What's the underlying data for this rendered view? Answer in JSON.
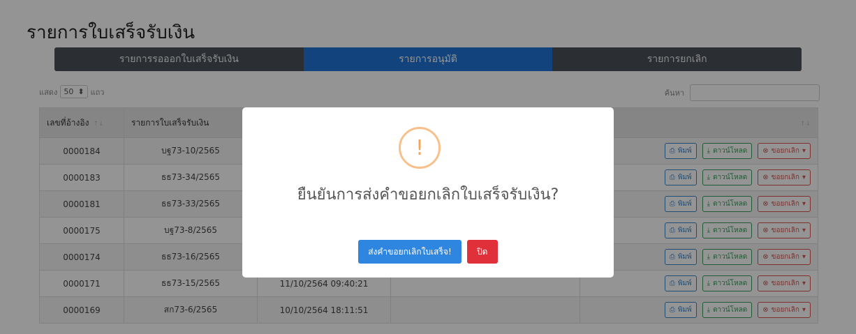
{
  "page": {
    "title": "รายการใบเสร็จรับเงิน"
  },
  "tabs": [
    {
      "label": "รายการรอออกใบเสร็จรับเงิน",
      "active": false
    },
    {
      "label": "รายการอนุมัติ",
      "active": true
    },
    {
      "label": "รายการยกเลิก",
      "active": false
    }
  ],
  "length": {
    "show": "แสดง",
    "value": "50",
    "unit": "แถว"
  },
  "search": {
    "label": "ค้นหา"
  },
  "table": {
    "headers": [
      "เลขที่อ้างอิง",
      "รายการใบเสร็จรับเงิน"
    ],
    "rows": [
      {
        "ref": "0000184",
        "receipt": "บฐ73-10/2565",
        "date": ""
      },
      {
        "ref": "0000183",
        "receipt": "ธธ73-34/2565",
        "date": ""
      },
      {
        "ref": "0000181",
        "receipt": "ธธ73-33/2565",
        "date": ""
      },
      {
        "ref": "0000175",
        "receipt": "บฐ73-8/2565",
        "date": ""
      },
      {
        "ref": "0000174",
        "receipt": "ธธ73-16/2565",
        "date": ""
      },
      {
        "ref": "0000171",
        "receipt": "ธธ73-15/2565",
        "date": "11/10/2564 09:40:21"
      },
      {
        "ref": "0000169",
        "receipt": "สก73-6/2565",
        "date": "10/10/2564 18:11:51"
      }
    ],
    "actions": {
      "print": "พิมพ์",
      "download": "ดาวน์โหลด",
      "cancel": "ขอยกเลิก"
    }
  },
  "modal": {
    "icon": "warning-icon",
    "title": "ยืนยันการส่งคำขอยกเลิกใบเสร็จรับเงิน?",
    "confirm": "ส่งคำขอยกเลิกใบเสร็จ!",
    "close": "ปิด"
  },
  "colors": {
    "active_tab": "#1f74d6",
    "confirm": "#2f86e1",
    "close": "#e0313b",
    "warning": "#f8c08a"
  }
}
